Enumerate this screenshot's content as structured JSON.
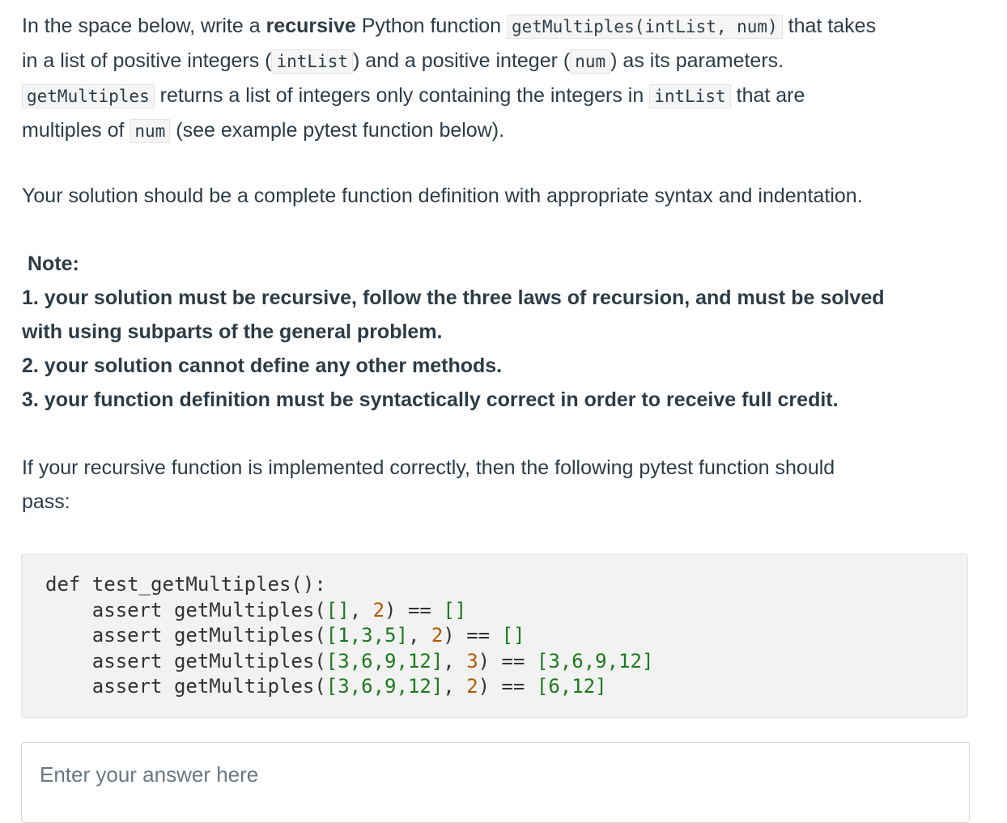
{
  "question": {
    "p1": {
      "t1": "In the space below, write a ",
      "bold1": "recursive",
      "t2": " Python function ",
      "code1": "getMultiples(intList, num)",
      "t3": " that takes",
      "t4": "in a list of positive integers (",
      "code2": "intList",
      "t5": ") and a positive integer (",
      "code3": "num",
      "t6": ") as its parameters.",
      "code4": "getMultiples",
      "t7": " returns a list of integers only containing the integers in ",
      "code5": "intList",
      "t8": " that are",
      "t9": "multiples of ",
      "code6": "num",
      "t10": " (see example pytest function below)."
    },
    "p2": "Your solution should be a complete function definition with appropriate syntax and indentation.",
    "note_title": "Note:",
    "note_lines": [
      "1. your solution must be recursive, follow the three laws of recursion, and must be solved",
      "with using subparts of the general problem.",
      "2. your solution cannot define any other methods.",
      "3. your function definition must be syntactically correct in order to receive full credit."
    ],
    "p3_line1": "If your recursive function is implemented correctly, then the following pytest function should",
    "p3_line2": "pass:"
  },
  "code": {
    "def_line": "def test_getMultiples():",
    "assert_prefix": "    assert getMultiples(",
    "asserts": [
      {
        "list": "[]",
        "num": "2",
        "expected": "[]"
      },
      {
        "list": "[1,3,5]",
        "num": "2",
        "expected": "[]"
      },
      {
        "list": "[3,6,9,12]",
        "num": "3",
        "expected": "[3,6,9,12]"
      },
      {
        "list": "[3,6,9,12]",
        "num": "2",
        "expected": "[6,12]"
      }
    ]
  },
  "answer": {
    "placeholder": "Enter your answer here",
    "value": ""
  }
}
